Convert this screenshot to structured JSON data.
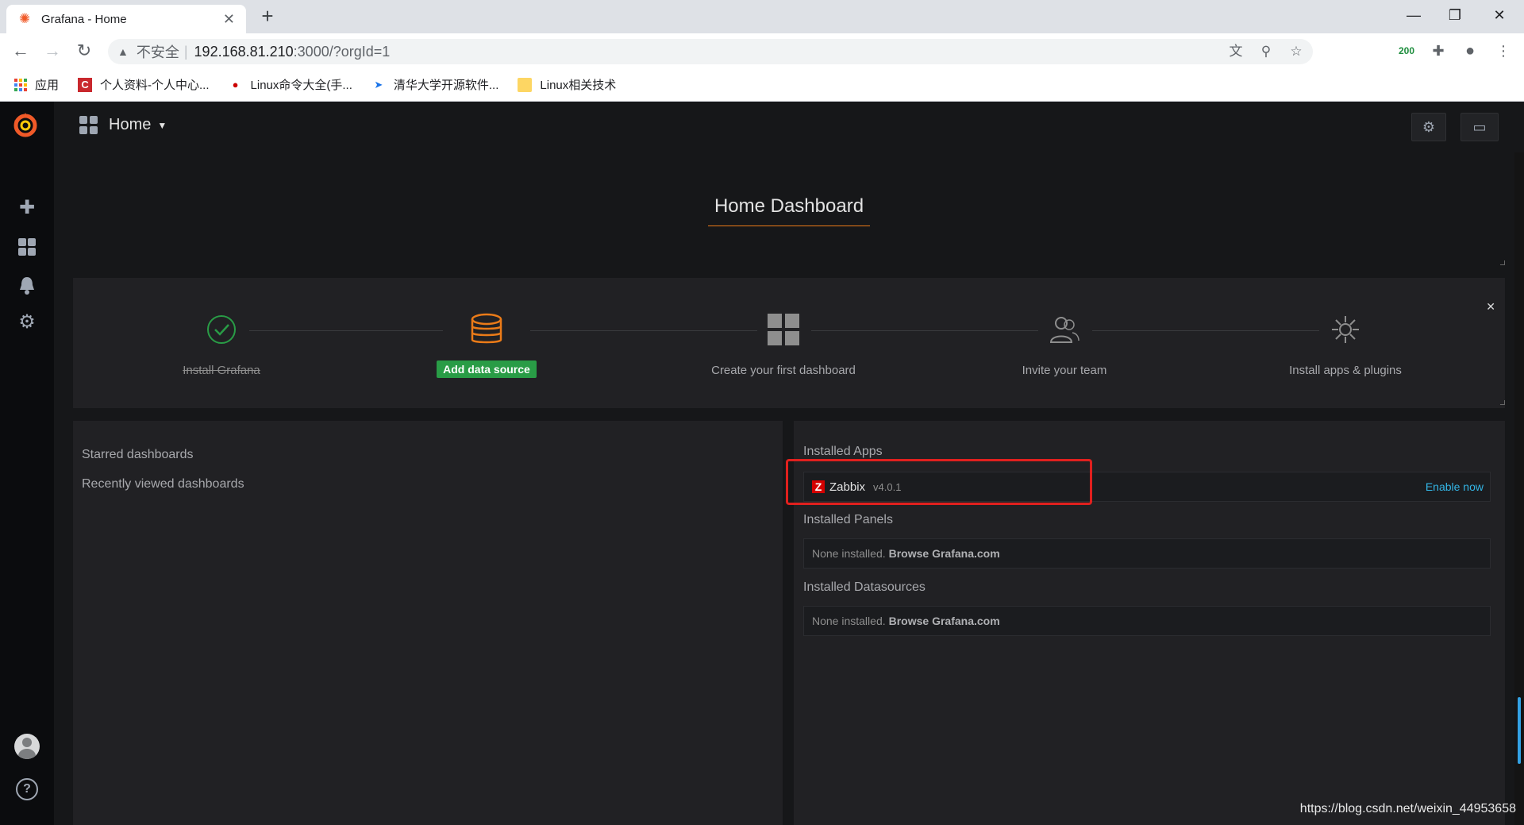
{
  "browser": {
    "tab_title": "Grafana - Home",
    "url_insecure": "不安全",
    "url_host": "192.168.81.210",
    "url_rest": ":3000/?orgId=1",
    "ext_badge": "200",
    "bookmarks": [
      {
        "label": "应用"
      },
      {
        "label": "个人资料-个人中心..."
      },
      {
        "label": "Linux命令大全(手..."
      },
      {
        "label": "清华大学开源软件..."
      },
      {
        "label": "Linux相关技术"
      }
    ]
  },
  "navbar": {
    "title": "Home"
  },
  "welcome": {
    "heading": "Home Dashboard"
  },
  "steps": [
    {
      "label": "Install Grafana",
      "done": true
    },
    {
      "label": "Add data source",
      "active": true
    },
    {
      "label": "Create your first dashboard"
    },
    {
      "label": "Invite your team"
    },
    {
      "label": "Install apps & plugins"
    }
  ],
  "left": {
    "starred": "Starred dashboards",
    "recent": "Recently viewed dashboards"
  },
  "right": {
    "apps_title": "Installed Apps",
    "app": {
      "icon_letter": "Z",
      "name": "Zabbix",
      "version": "v4.0.1",
      "action": "Enable now"
    },
    "panels_title": "Installed Panels",
    "panels_none": "None installed.",
    "panels_link": "Browse Grafana.com",
    "ds_title": "Installed Datasources",
    "ds_none": "None installed.",
    "ds_link": "Browse Grafana.com"
  },
  "watermark": "https://blog.csdn.net/weixin_44953658",
  "colors": {
    "accent": "#eb7b18",
    "green": "#299c46",
    "link": "#33b5e5",
    "highlight": "#e0201e"
  }
}
